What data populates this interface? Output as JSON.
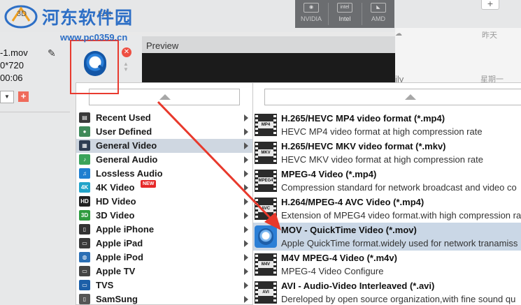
{
  "watermark": {
    "title": "河东软件园",
    "url": "www.pc0359.cn"
  },
  "toolbar": {
    "label_3d": "3D",
    "label_edit": "Edit",
    "add_label": "+",
    "gpus": [
      {
        "name": "NVIDIA",
        "logo": "nvidia-icon"
      },
      {
        "name": "Intel",
        "logo": "intel-icon"
      },
      {
        "name": "AMD",
        "logo": "amd-icon"
      }
    ]
  },
  "file": {
    "name": "-1.mov",
    "resolution": "0*720",
    "duration": "00:06",
    "dropdown_icon": "chevron-down-icon",
    "add_label": "+"
  },
  "item_actions": {
    "remove_label": "✕",
    "up": "▲",
    "down": "▼"
  },
  "preview": {
    "label": "Preview"
  },
  "chat": {
    "yesterday": "昨天",
    "monday": "星期一",
    "partial_text": "ily"
  },
  "categories": [
    {
      "label": "Recent Used",
      "icon": "clock-icon",
      "color": "#3a3a3a",
      "glyph": "▤",
      "selected": false,
      "badge": ""
    },
    {
      "label": "User Defined",
      "icon": "user-defined-icon",
      "color": "#3f8a5a",
      "glyph": "●",
      "selected": false,
      "badge": ""
    },
    {
      "label": "General Video",
      "icon": "film-icon",
      "color": "#2f3d52",
      "glyph": "▦",
      "selected": true,
      "badge": ""
    },
    {
      "label": "General Audio",
      "icon": "music-note-icon",
      "color": "#3aa35a",
      "glyph": "♪",
      "selected": false,
      "badge": ""
    },
    {
      "label": "Lossless Audio",
      "icon": "lossless-audio-icon",
      "color": "#1f7fd0",
      "glyph": "♫",
      "selected": false,
      "badge": ""
    },
    {
      "label": "4K Video",
      "icon": "4k-icon",
      "color": "#22a4c9",
      "glyph": "4K",
      "selected": false,
      "badge": "NEW"
    },
    {
      "label": "HD Video",
      "icon": "hd-icon",
      "color": "#222222",
      "glyph": "HD",
      "selected": false,
      "badge": ""
    },
    {
      "label": "3D Video",
      "icon": "3d-icon",
      "color": "#2f9b3f",
      "glyph": "3D",
      "selected": false,
      "badge": ""
    },
    {
      "label": "Apple iPhone",
      "icon": "iphone-icon",
      "color": "#333333",
      "glyph": "▯",
      "selected": false,
      "badge": ""
    },
    {
      "label": "Apple iPad",
      "icon": "ipad-icon",
      "color": "#3a3a3a",
      "glyph": "▭",
      "selected": false,
      "badge": ""
    },
    {
      "label": "Apple iPod",
      "icon": "ipod-icon",
      "color": "#2b6fb5",
      "glyph": "◍",
      "selected": false,
      "badge": ""
    },
    {
      "label": "Apple TV",
      "icon": "apple-tv-icon",
      "color": "#444444",
      "glyph": "▭",
      "selected": false,
      "badge": ""
    },
    {
      "label": "TVS",
      "icon": "tv-icon",
      "color": "#1c5fa8",
      "glyph": "▭",
      "selected": false,
      "badge": ""
    },
    {
      "label": "SamSung",
      "icon": "samsung-icon",
      "color": "#555555",
      "glyph": "▯",
      "selected": false,
      "badge": ""
    }
  ],
  "formats": [
    {
      "title": "H.265/HEVC MP4 video format (*.mp4)",
      "desc": "HEVC MP4 video format at high compression rate",
      "tag": "MP4",
      "icon": "mp4-film-icon",
      "selected": false
    },
    {
      "title": "H.265/HEVC MKV video format (*.mkv)",
      "desc": "HEVC MKV video format at high compression rate",
      "tag": "MKV",
      "icon": "mkv-film-icon",
      "selected": false
    },
    {
      "title": "MPEG-4 Video (*.mp4)",
      "desc": "Compression standard for network broadcast and video co",
      "tag": "MPEG4",
      "icon": "mpeg4-film-icon",
      "selected": false
    },
    {
      "title": "H.264/MPEG-4 AVC Video (*.mp4)",
      "desc": "Extension of MPEG4 video format.with high compression ra",
      "tag": "AVC",
      "icon": "avc-film-icon",
      "selected": false
    },
    {
      "title": "MOV - QuickTime Video (*.mov)",
      "desc": "Apple QuickTime format.widely used for network tranamiss",
      "tag": "",
      "icon": "quicktime-icon",
      "selected": true
    },
    {
      "title": "M4V MPEG-4 Video (*.m4v)",
      "desc": "MPEG-4 Video Configure",
      "tag": "M4V",
      "icon": "m4v-film-icon",
      "selected": false
    },
    {
      "title": "AVI - Audio-Video Interleaved (*.avi)",
      "desc": "Dereloped by open source organization,with fine sound qu",
      "tag": "AVI",
      "icon": "avi-film-icon",
      "selected": false
    }
  ],
  "colors": {
    "annotation": "#e8392c",
    "selection": "#cad7e6",
    "accent": "#2d6fc6"
  }
}
